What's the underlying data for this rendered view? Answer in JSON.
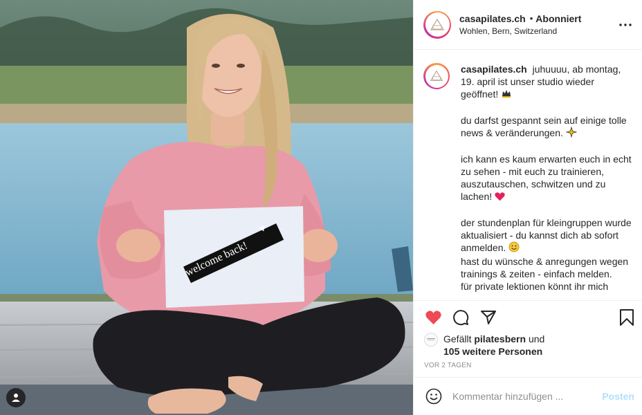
{
  "post": {
    "username": "casapilates.ch",
    "separator": "•",
    "follow_status": "Abonniert",
    "location": "Wohlen, Bern, Switzerland"
  },
  "photo": {
    "sign_text": "welcome back!"
  },
  "caption": {
    "username": "casapilates.ch",
    "lines": [
      "juhuuuu, ab montag, 19. april ist unser studio wieder geöffnet!",
      "du darfst gespannt sein auf einige tolle news & veränderungen.",
      "ich kann es kaum erwarten euch in echt zu sehen - mit euch zu trainieren, auszutauschen, schwitzen und zu lachen!",
      "der stundenplan für kleingruppen wurde aktualisiert - du kannst dich ab sofort anmelden.",
      "hast du wünsche & anregungen wegen trainings & zeiten - einfach melden.",
      "für private lektionen könnt ihr mich"
    ]
  },
  "likes": {
    "prefix": "Gefällt",
    "liker": "pilatesbern",
    "connector": "und",
    "others": "105 weitere Personen"
  },
  "timestamp": "VOR 2 TAGEN",
  "comment_box": {
    "placeholder": "Kommentar hinzufügen ...",
    "post_label": "Posten"
  },
  "icons": {
    "like": "heart-icon",
    "comment": "comment-icon",
    "share": "paper-plane-icon",
    "save": "bookmark-icon",
    "more": "more-options-icon",
    "emoji": "smiley-icon",
    "user_tag": "user-tag-icon"
  },
  "colors": {
    "like_red": "#ed4956",
    "post_button": "#b2dffc",
    "text": "#262626",
    "muted": "#8e8e8e",
    "divider": "#efefef"
  }
}
